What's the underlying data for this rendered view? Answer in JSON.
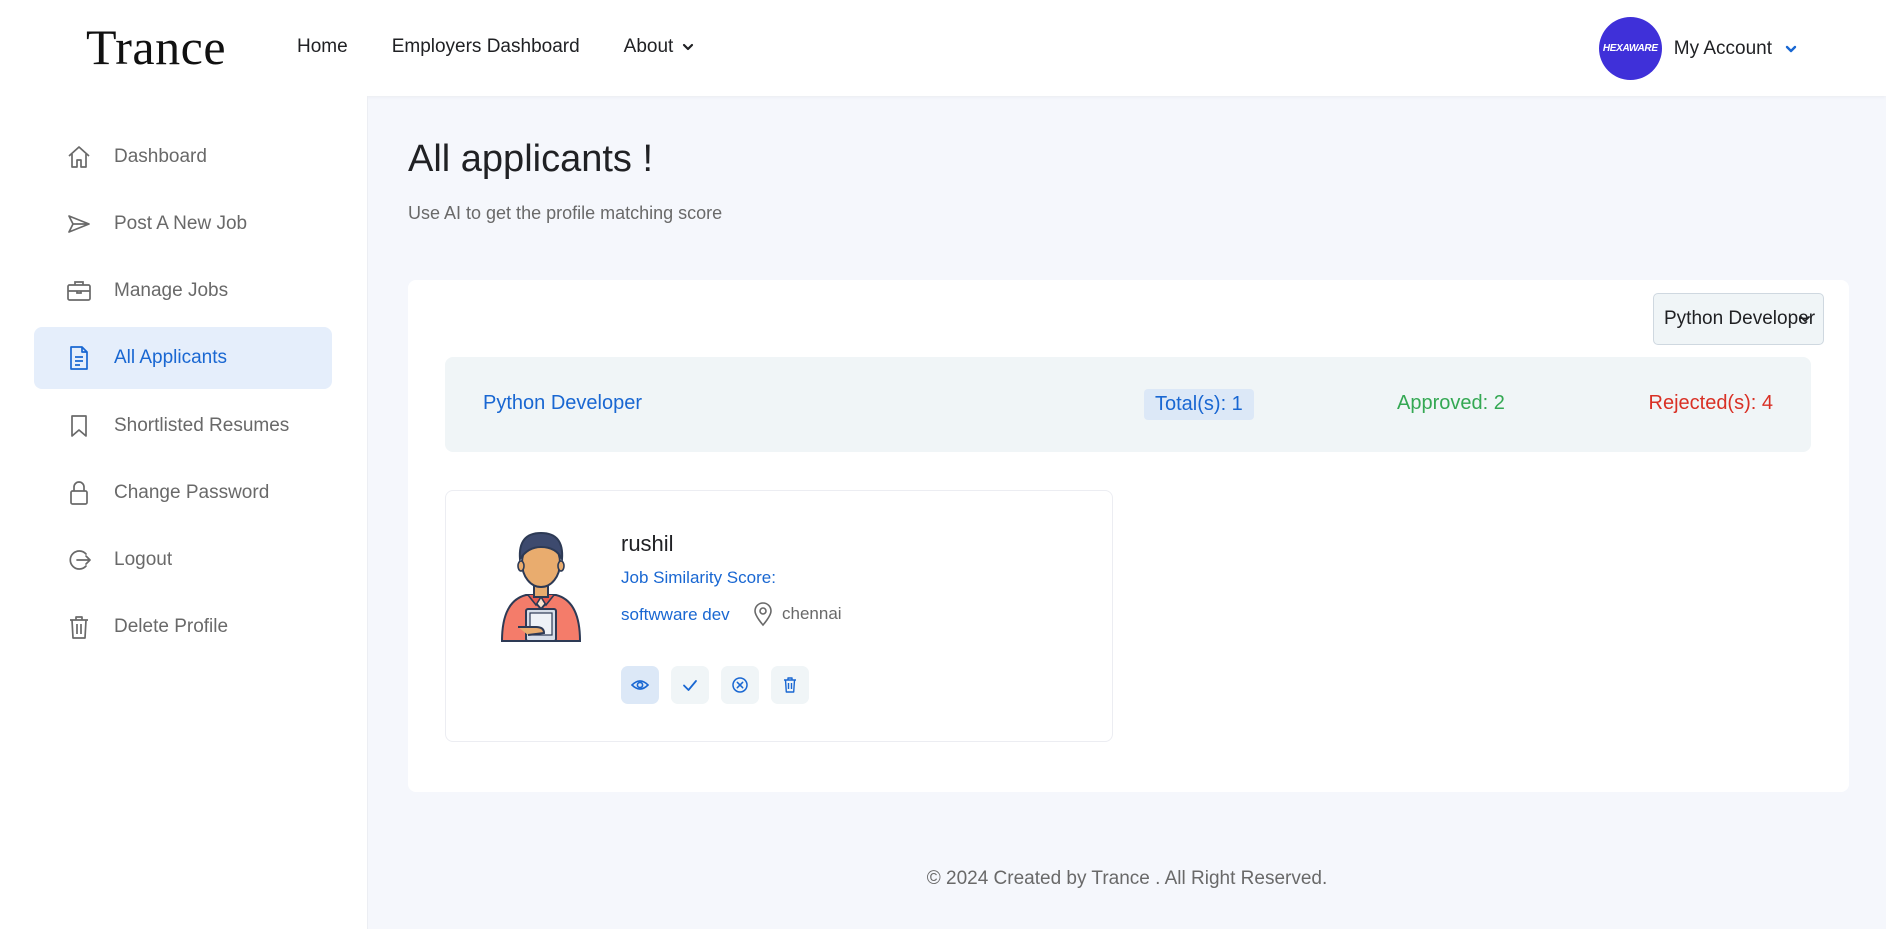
{
  "header": {
    "logo": "Trance",
    "nav": [
      {
        "label": "Home"
      },
      {
        "label": "Employers Dashboard"
      },
      {
        "label": "About",
        "has_dropdown": true
      }
    ],
    "account": {
      "avatar_text": "HEXAWARE",
      "label": "My Account"
    }
  },
  "sidebar": {
    "items": [
      {
        "label": "Dashboard",
        "icon": "home-icon"
      },
      {
        "label": "Post A New Job",
        "icon": "paper-plane-icon"
      },
      {
        "label": "Manage Jobs",
        "icon": "briefcase-icon"
      },
      {
        "label": "All Applicants",
        "icon": "document-icon",
        "active": true
      },
      {
        "label": "Shortlisted Resumes",
        "icon": "bookmark-icon"
      },
      {
        "label": "Change Password",
        "icon": "lock-icon"
      },
      {
        "label": "Logout",
        "icon": "logout-icon"
      },
      {
        "label": "Delete Profile",
        "icon": "trash-icon"
      }
    ]
  },
  "main": {
    "title": "All applicants !",
    "subtitle": "Use AI to get the profile matching score",
    "job_select": {
      "value": "Python Developer"
    },
    "summary": {
      "job": "Python Developer",
      "total": "Total(s): 1",
      "approved": "Approved: 2",
      "rejected": "Rejected(s): 4"
    },
    "applicants": [
      {
        "name": "rushil",
        "score_label": "Job Similarity Score:",
        "role": "softwware dev",
        "location": "chennai",
        "actions": [
          "eye-icon",
          "check-icon",
          "close-circle-icon",
          "trash-icon"
        ]
      }
    ]
  },
  "footer": {
    "text": "© 2024 Created by Trance . All Right Reserved."
  },
  "colors": {
    "accent": "#1967d2",
    "approved": "#34a853",
    "rejected": "#d93025",
    "avatar_bg": "#3f30d9"
  }
}
